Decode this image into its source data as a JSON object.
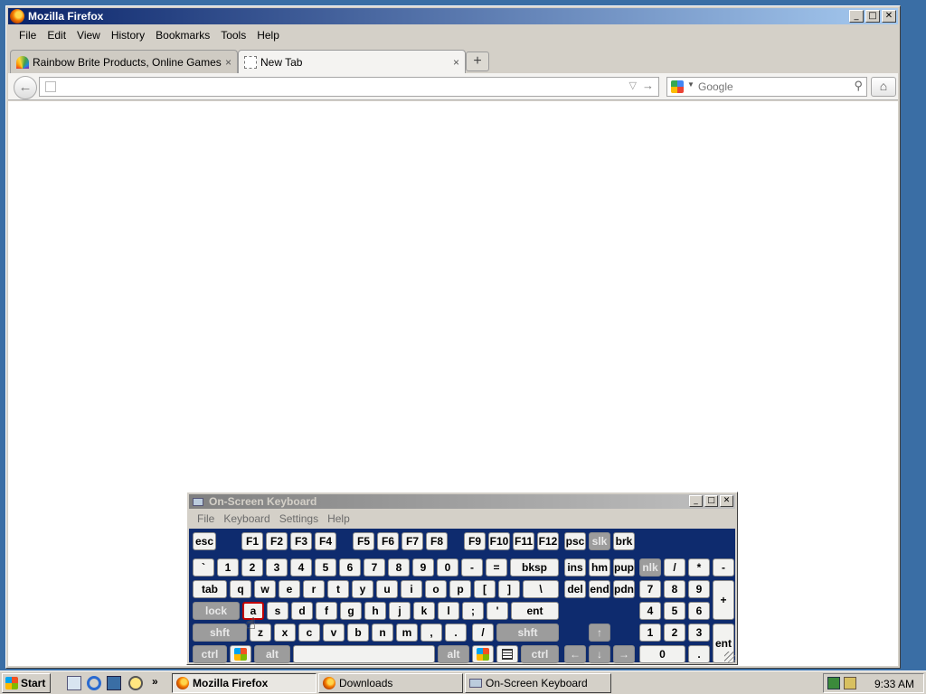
{
  "firefox": {
    "title": "Mozilla Firefox",
    "menu": [
      "File",
      "Edit",
      "View",
      "History",
      "Bookmarks",
      "Tools",
      "Help"
    ],
    "tabs": [
      {
        "label": "Rainbow Brite Products, Online Games, D...",
        "close": "×"
      },
      {
        "label": "New Tab",
        "close": "×"
      }
    ],
    "new_tab": "+",
    "url_value": "",
    "search_placeholder": "Google",
    "window_buttons": {
      "minimize": "_",
      "maximize": "□",
      "close": "✕"
    }
  },
  "osk": {
    "title": "On-Screen Keyboard",
    "menu": [
      "File",
      "Keyboard",
      "Settings",
      "Help"
    ],
    "window_buttons": {
      "minimize": "_",
      "maximize": "□",
      "close": "✕"
    },
    "highlighted_key": "a"
  },
  "taskbar": {
    "start": "Start",
    "quicklaunch_more": "»",
    "tasks": [
      "Mozilla Firefox",
      "Downloads",
      "On-Screen Keyboard"
    ],
    "active_task": "Mozilla Firefox",
    "clock": "9:33 AM"
  },
  "icons": {
    "firefox": "firefox-icon",
    "back": "back-arrow-icon",
    "home": "home-icon",
    "search": "magnifier-icon",
    "keyboard": "keyboard-icon",
    "windows": "windows-logo-icon"
  }
}
